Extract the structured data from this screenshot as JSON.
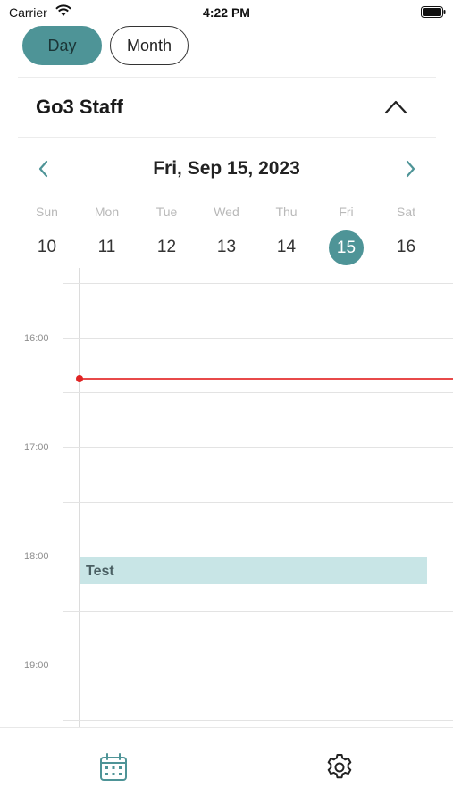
{
  "status_bar": {
    "carrier": "Carrier",
    "time": "4:22 PM"
  },
  "view_toggle": {
    "day_label": "Day",
    "month_label": "Month",
    "active": "Day"
  },
  "staff_section": {
    "title": "Go3 Staff"
  },
  "date_nav": {
    "current_date": "Fri, Sep 15, 2023"
  },
  "week": {
    "days": [
      {
        "dow": "Sun",
        "dom": "10"
      },
      {
        "dow": "Mon",
        "dom": "11"
      },
      {
        "dow": "Tue",
        "dom": "12"
      },
      {
        "dow": "Wed",
        "dom": "13"
      },
      {
        "dow": "Thu",
        "dom": "14"
      },
      {
        "dow": "Fri",
        "dom": "15"
      },
      {
        "dow": "Sat",
        "dom": "16"
      }
    ],
    "selected_index": 5
  },
  "timeline": {
    "hour_labels": [
      "16:00",
      "17:00",
      "18:00",
      "19:00"
    ],
    "events": [
      {
        "title": "Test",
        "start": "18:00"
      }
    ]
  },
  "colors": {
    "accent": "#4e9497",
    "now_indicator": "#e02424",
    "event_bg": "#c8e5e6"
  },
  "tab_bar": {
    "tabs": [
      {
        "icon": "calendar-icon"
      },
      {
        "icon": "gear-icon"
      }
    ]
  }
}
